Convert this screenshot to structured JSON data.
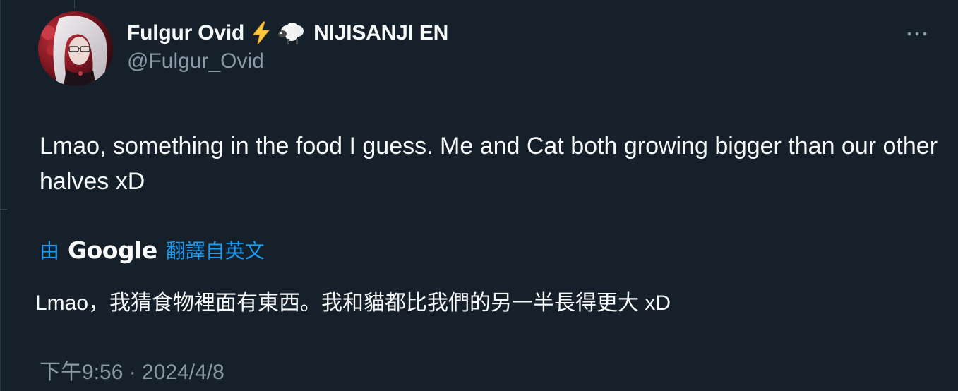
{
  "author": {
    "display_name": "Fulgur Ovid",
    "org_name": "NIJISANJI EN",
    "handle": "@Fulgur_Ovid",
    "badge_icon": "lightning-bolt-icon",
    "org_icon": "sheep-icon"
  },
  "tweet": {
    "text": "Lmao, something in the food I guess. Me and Cat both growing bigger than our other halves xD"
  },
  "translation": {
    "prefix": "由",
    "provider": "Google",
    "suffix": "翻譯自英文",
    "text": "Lmao，我猜食物裡面有東西。我和貓都比我們的另一半長得更大 xD"
  },
  "meta": {
    "timestamp": "下午9:56 · 2024/4/8"
  },
  "colors": {
    "background": "#15202b",
    "text_primary": "#f7f9f9",
    "text_secondary": "#8b98a5",
    "link": "#1d9bf0"
  }
}
